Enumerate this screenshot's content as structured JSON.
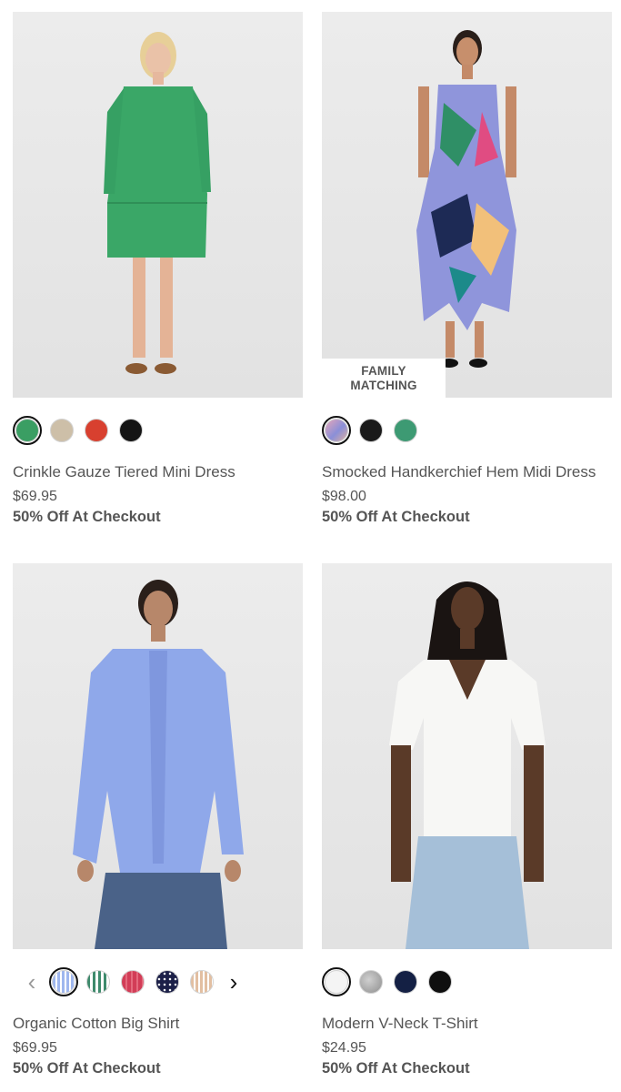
{
  "products": [
    {
      "name": "Crinkle Gauze Tiered Mini Dress",
      "price": "$69.95",
      "promo": "50% Off At Checkout",
      "badge": null,
      "image_desc": "woman-in-green-dress",
      "swatches": [
        {
          "color": "#3a9e63",
          "selected": true
        },
        {
          "color": "#cdbfa8",
          "selected": false
        },
        {
          "color": "#d8402f",
          "selected": false
        },
        {
          "color": "#141414",
          "selected": false
        }
      ]
    },
    {
      "name": "Smocked Handkerchief Hem Midi Dress",
      "price": "$98.00",
      "promo": "50% Off At Checkout",
      "badge": {
        "line1": "FAMILY",
        "line2": "MATCHING"
      },
      "image_desc": "woman-in-floral-midi-dress",
      "swatches": [
        {
          "color": "#8a8fd8",
          "selected": true
        },
        {
          "color": "#1a1a1a",
          "selected": false
        },
        {
          "color": "#3d9a73",
          "selected": false
        }
      ]
    },
    {
      "name": "Organic Cotton Big Shirt",
      "price": "$69.95",
      "promo": "50% Off At Checkout",
      "badge": null,
      "image_desc": "woman-in-blue-striped-shirt",
      "swatches": [
        {
          "color": "#9fb7ee",
          "selected": true
        },
        {
          "color": "#3e8a6c",
          "selected": false
        },
        {
          "color": "#d23d57",
          "selected": false
        },
        {
          "color": "#1c2048",
          "selected": false
        },
        {
          "color": "#e2bfa2",
          "selected": false
        }
      ]
    },
    {
      "name": "Modern V-Neck T-Shirt",
      "price": "$24.95",
      "promo": "50% Off At Checkout",
      "badge": null,
      "image_desc": "woman-in-white-v-neck-tee",
      "swatches": [
        {
          "color": "#f4f4f4",
          "selected": true
        },
        {
          "color": "#a9a9a9",
          "selected": false
        },
        {
          "color": "#142044",
          "selected": false
        },
        {
          "color": "#0f0f0f",
          "selected": false
        }
      ]
    }
  ],
  "carousel": {
    "prev_icon": "chevron-left-icon",
    "next_icon": "chevron-right-icon"
  }
}
